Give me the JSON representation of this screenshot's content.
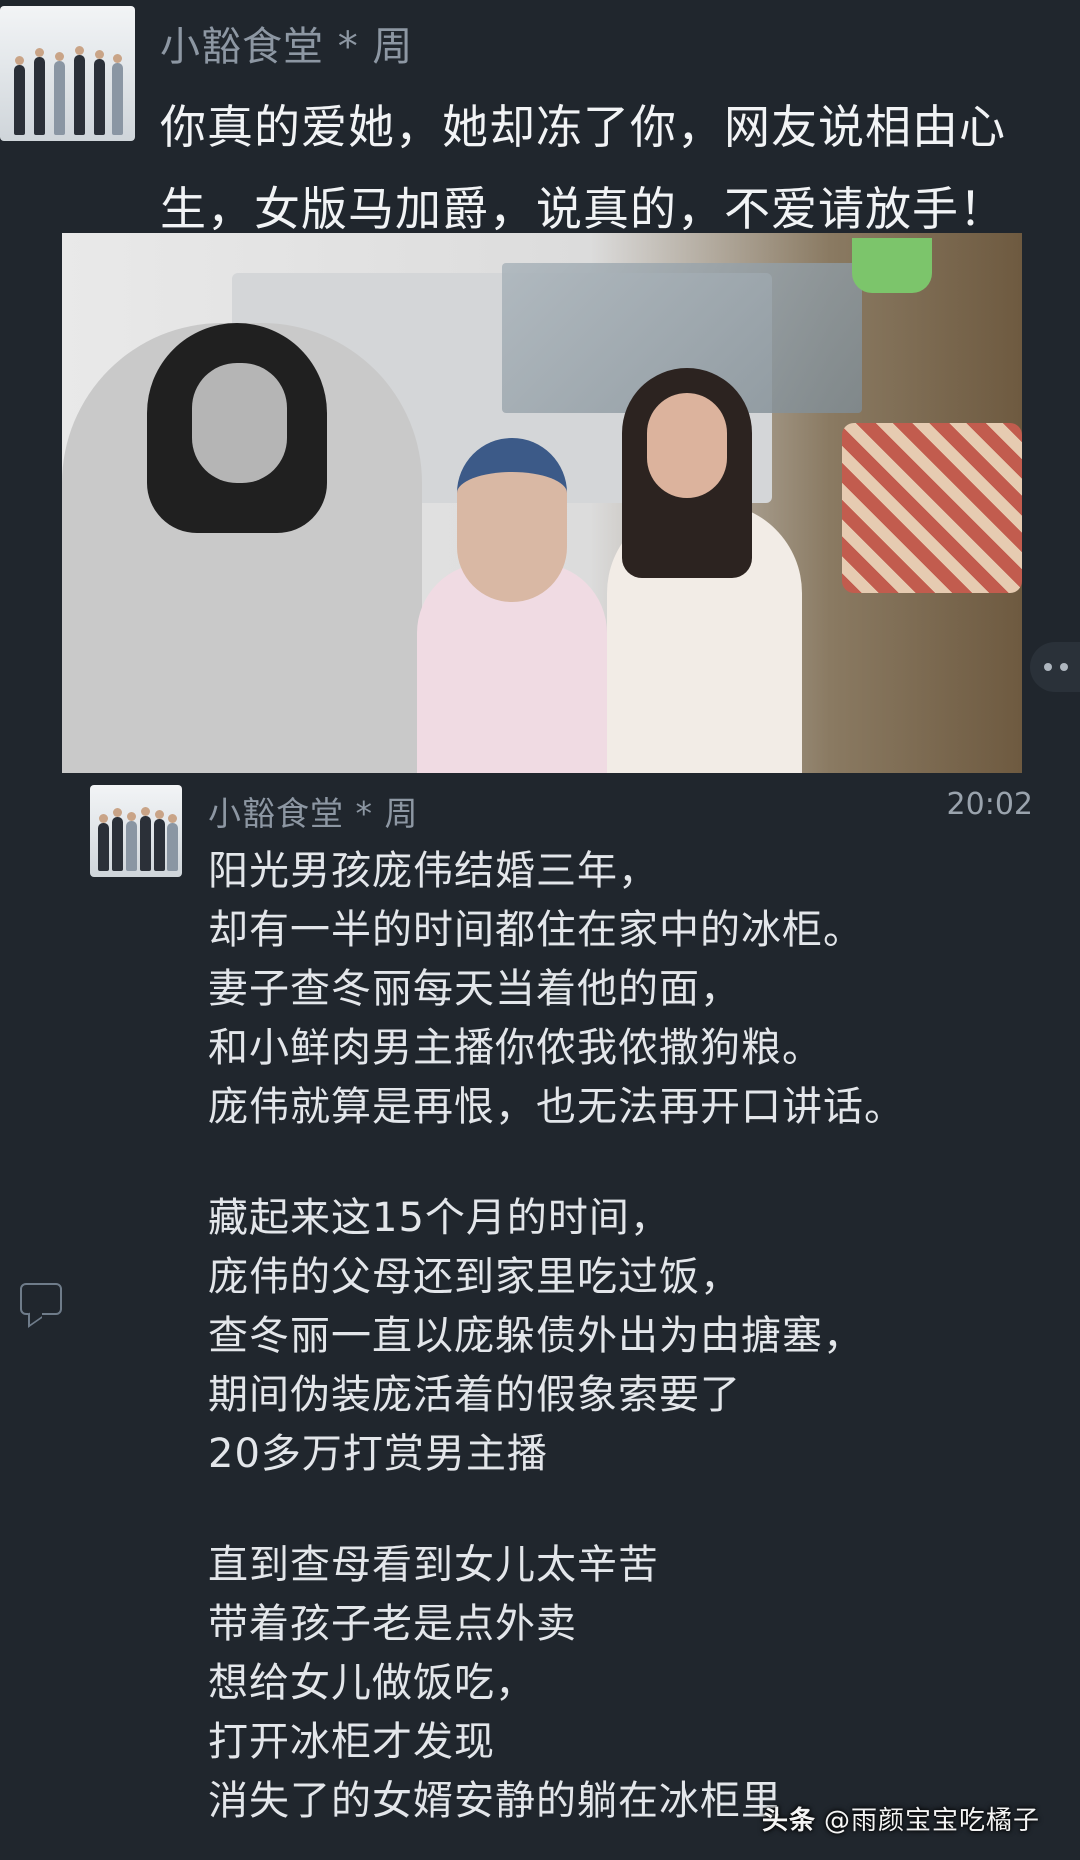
{
  "post": {
    "author": "小豁食堂 * 周",
    "text_line1": "你真的爱她，她却冻了你，网友说相由心",
    "text_line2": "生，女版马加爵，说真的，不爱请放手！"
  },
  "message": {
    "author": "小豁食堂 * 周",
    "time": "20:02",
    "lines": [
      "阳光男孩庞伟结婚三年，",
      "却有一半的时间都住在家中的冰柜。",
      "妻子查冬丽每天当着他的面，",
      "和小鲜肉男主播你侬我侬撒狗粮。",
      "庞伟就算是再恨，也无法再开口讲话。",
      "",
      "藏起来这15个月的时间，",
      "庞伟的父母还到家里吃过饭，",
      "查冬丽一直以庞躲债外出为由搪塞，",
      "期间伪装庞活着的假象索要了",
      "20多万打赏男主播",
      "",
      "直到查母看到女儿太辛苦",
      "带着孩子老是点外卖",
      "想给女儿做饭吃，",
      "打开冰柜才发现",
      "消失了的女婿安静的躺在冰柜里"
    ]
  },
  "watermark": {
    "brand": "头条",
    "handle": "@雨颜宝宝吃橘子"
  },
  "icons": {
    "more": "more-dots-icon",
    "comment": "comment-icon"
  }
}
